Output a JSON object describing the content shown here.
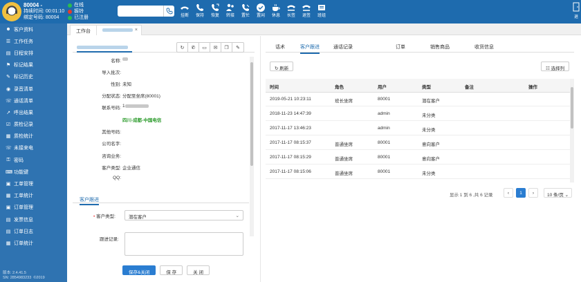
{
  "topbar": {
    "agent_id": "80004 -",
    "duration": "持续时间: 00:01:10",
    "binding": "绑定号码: 80004",
    "status": [
      {
        "label": "在线",
        "color": "#2bbd4e"
      },
      {
        "label": "振铃",
        "color": "#e33b2e"
      },
      {
        "label": "已注册",
        "color": "#2bbd4e"
      }
    ],
    "dial_placeholder": "",
    "tools": [
      {
        "label": "挂断",
        "icon": "hangup-icon"
      },
      {
        "label": "保持",
        "icon": "hold-icon"
      },
      {
        "label": "恢复",
        "icon": "resume-icon"
      },
      {
        "label": "转接",
        "icon": "transfer-icon"
      },
      {
        "label": "置忙",
        "icon": "busy-icon"
      },
      {
        "label": "置闲",
        "icon": "idle-icon"
      },
      {
        "label": "休息",
        "icon": "rest-icon"
      },
      {
        "label": "长签",
        "icon": "long-sign-icon"
      },
      {
        "label": "退签",
        "icon": "sign-out-icon"
      },
      {
        "label": "班组",
        "icon": "group-icon"
      }
    ],
    "exit_label": "退"
  },
  "sidebar": {
    "items": [
      {
        "label": "客户资料",
        "icon": "user-icon"
      },
      {
        "label": "工作任务",
        "icon": "task-icon"
      },
      {
        "label": "日程安排",
        "icon": "calendar-icon"
      },
      {
        "label": "标记结果",
        "icon": "tag-icon"
      },
      {
        "label": "标记历史",
        "icon": "history-icon"
      },
      {
        "label": "录音清单",
        "icon": "record-icon"
      },
      {
        "label": "通话清单",
        "icon": "call-list-icon"
      },
      {
        "label": "呼出结果",
        "icon": "outbound-icon"
      },
      {
        "label": "质检记录",
        "icon": "qc-record-icon"
      },
      {
        "label": "质检统计",
        "icon": "qc-stat-icon"
      },
      {
        "label": "未接来电",
        "icon": "missed-call-icon"
      },
      {
        "label": "密码",
        "icon": "lock-icon"
      },
      {
        "label": "功能键",
        "icon": "function-key-icon"
      },
      {
        "label": "工单管理",
        "icon": "ticket-icon"
      },
      {
        "label": "工单统计",
        "icon": "ticket-stat-icon"
      },
      {
        "label": "订单管理",
        "icon": "order-icon"
      },
      {
        "label": "发票信息",
        "icon": "invoice-icon"
      },
      {
        "label": "订单日志",
        "icon": "order-log-icon"
      },
      {
        "label": "订单统计",
        "icon": "order-stat-icon"
      }
    ],
    "version": "版本: 2.4.41.5",
    "sn": "SN: 2854983233",
    "copyright": "©2019"
  },
  "tabs": {
    "workbench": "工作台",
    "close": "×"
  },
  "customer": {
    "fields": [
      {
        "key": "名称:",
        "value": ""
      },
      {
        "key": "导入批次:",
        "value": ""
      },
      {
        "key": "性别:",
        "value": "未知"
      },
      {
        "key": "分配状态:",
        "value": "分配至坐席(80001)"
      },
      {
        "key": "联系号码:",
        "value": "1"
      },
      {
        "key": "",
        "value": "四川-成都-中国电信"
      },
      {
        "key": "其他号码:",
        "value": ""
      },
      {
        "key": "公司名字:",
        "value": ""
      },
      {
        "key": "咨询业务:",
        "value": ""
      },
      {
        "key": "客户类型:",
        "value": "企业通信"
      },
      {
        "key": "QQ:",
        "value": ""
      }
    ],
    "followup_tab": "客户跟进",
    "type_label": "客户类型:",
    "type_value": "潜在客户",
    "record_label": "跟进记录:",
    "buttons": {
      "save_close": "保存&关闭",
      "save": "保 存",
      "close": "关 闭"
    }
  },
  "right": {
    "tabs": [
      "话术",
      "客户跟进",
      "通话记录",
      "订单",
      "销售商品",
      "收货信息"
    ],
    "active_tab": 1,
    "refresh": "刷新",
    "choose_cols": "选择列",
    "columns": [
      "时间",
      "角色",
      "用户",
      "类型",
      "备注",
      "操作"
    ],
    "rows": [
      [
        "2019-05-21 10:23:11",
        "班长坐席",
        "80001",
        "潜在客户",
        "",
        ""
      ],
      [
        "2018-11-23 14:47:39",
        "",
        "admin",
        "未分类",
        "",
        ""
      ],
      [
        "2017-11-17 13:46:23",
        "",
        "admin",
        "未分类",
        "",
        ""
      ],
      [
        "2017-11-17 08:15:37",
        "普通坐席",
        "80001",
        "意向客户",
        "",
        ""
      ],
      [
        "2017-11-17 08:15:29",
        "普通坐席",
        "80001",
        "意向客户",
        "",
        ""
      ],
      [
        "2017-11-17 08:15:06",
        "普通坐席",
        "80001",
        "未分类",
        "",
        ""
      ]
    ],
    "pager": {
      "info": "显示 1 到 6 ,共 6 记录",
      "prev": "‹",
      "page": "1",
      "next": "›",
      "per_page": "10 条/页"
    }
  }
}
